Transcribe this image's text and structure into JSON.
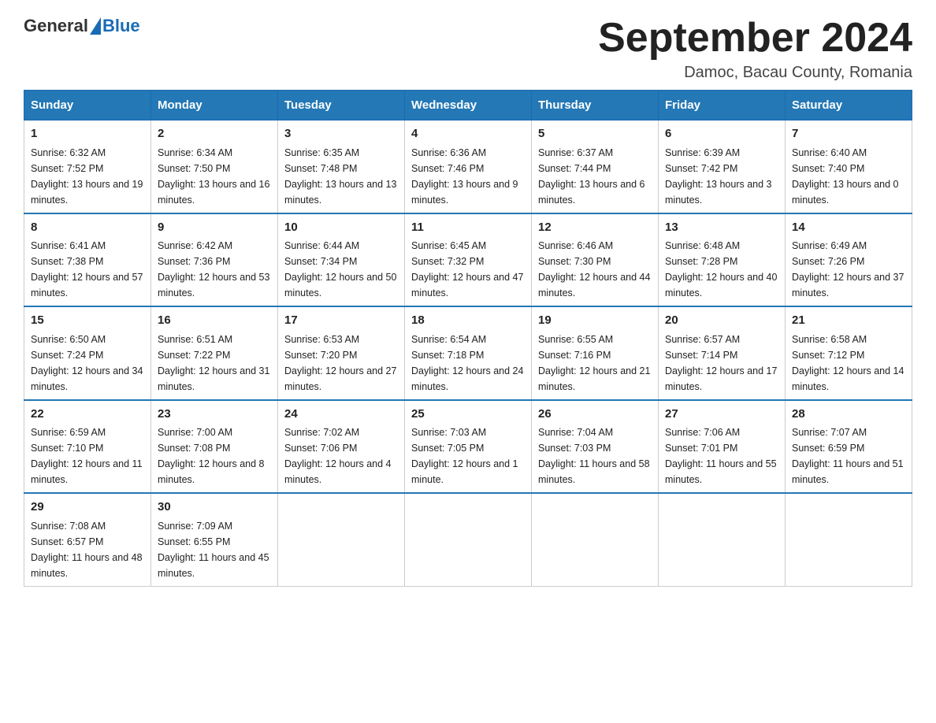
{
  "header": {
    "logo_general": "General",
    "logo_blue": "Blue",
    "month_title": "September 2024",
    "location": "Damoc, Bacau County, Romania"
  },
  "weekdays": [
    "Sunday",
    "Monday",
    "Tuesday",
    "Wednesday",
    "Thursday",
    "Friday",
    "Saturday"
  ],
  "weeks": [
    [
      {
        "day": "1",
        "sunrise": "Sunrise: 6:32 AM",
        "sunset": "Sunset: 7:52 PM",
        "daylight": "Daylight: 13 hours and 19 minutes."
      },
      {
        "day": "2",
        "sunrise": "Sunrise: 6:34 AM",
        "sunset": "Sunset: 7:50 PM",
        "daylight": "Daylight: 13 hours and 16 minutes."
      },
      {
        "day": "3",
        "sunrise": "Sunrise: 6:35 AM",
        "sunset": "Sunset: 7:48 PM",
        "daylight": "Daylight: 13 hours and 13 minutes."
      },
      {
        "day": "4",
        "sunrise": "Sunrise: 6:36 AM",
        "sunset": "Sunset: 7:46 PM",
        "daylight": "Daylight: 13 hours and 9 minutes."
      },
      {
        "day": "5",
        "sunrise": "Sunrise: 6:37 AM",
        "sunset": "Sunset: 7:44 PM",
        "daylight": "Daylight: 13 hours and 6 minutes."
      },
      {
        "day": "6",
        "sunrise": "Sunrise: 6:39 AM",
        "sunset": "Sunset: 7:42 PM",
        "daylight": "Daylight: 13 hours and 3 minutes."
      },
      {
        "day": "7",
        "sunrise": "Sunrise: 6:40 AM",
        "sunset": "Sunset: 7:40 PM",
        "daylight": "Daylight: 13 hours and 0 minutes."
      }
    ],
    [
      {
        "day": "8",
        "sunrise": "Sunrise: 6:41 AM",
        "sunset": "Sunset: 7:38 PM",
        "daylight": "Daylight: 12 hours and 57 minutes."
      },
      {
        "day": "9",
        "sunrise": "Sunrise: 6:42 AM",
        "sunset": "Sunset: 7:36 PM",
        "daylight": "Daylight: 12 hours and 53 minutes."
      },
      {
        "day": "10",
        "sunrise": "Sunrise: 6:44 AM",
        "sunset": "Sunset: 7:34 PM",
        "daylight": "Daylight: 12 hours and 50 minutes."
      },
      {
        "day": "11",
        "sunrise": "Sunrise: 6:45 AM",
        "sunset": "Sunset: 7:32 PM",
        "daylight": "Daylight: 12 hours and 47 minutes."
      },
      {
        "day": "12",
        "sunrise": "Sunrise: 6:46 AM",
        "sunset": "Sunset: 7:30 PM",
        "daylight": "Daylight: 12 hours and 44 minutes."
      },
      {
        "day": "13",
        "sunrise": "Sunrise: 6:48 AM",
        "sunset": "Sunset: 7:28 PM",
        "daylight": "Daylight: 12 hours and 40 minutes."
      },
      {
        "day": "14",
        "sunrise": "Sunrise: 6:49 AM",
        "sunset": "Sunset: 7:26 PM",
        "daylight": "Daylight: 12 hours and 37 minutes."
      }
    ],
    [
      {
        "day": "15",
        "sunrise": "Sunrise: 6:50 AM",
        "sunset": "Sunset: 7:24 PM",
        "daylight": "Daylight: 12 hours and 34 minutes."
      },
      {
        "day": "16",
        "sunrise": "Sunrise: 6:51 AM",
        "sunset": "Sunset: 7:22 PM",
        "daylight": "Daylight: 12 hours and 31 minutes."
      },
      {
        "day": "17",
        "sunrise": "Sunrise: 6:53 AM",
        "sunset": "Sunset: 7:20 PM",
        "daylight": "Daylight: 12 hours and 27 minutes."
      },
      {
        "day": "18",
        "sunrise": "Sunrise: 6:54 AM",
        "sunset": "Sunset: 7:18 PM",
        "daylight": "Daylight: 12 hours and 24 minutes."
      },
      {
        "day": "19",
        "sunrise": "Sunrise: 6:55 AM",
        "sunset": "Sunset: 7:16 PM",
        "daylight": "Daylight: 12 hours and 21 minutes."
      },
      {
        "day": "20",
        "sunrise": "Sunrise: 6:57 AM",
        "sunset": "Sunset: 7:14 PM",
        "daylight": "Daylight: 12 hours and 17 minutes."
      },
      {
        "day": "21",
        "sunrise": "Sunrise: 6:58 AM",
        "sunset": "Sunset: 7:12 PM",
        "daylight": "Daylight: 12 hours and 14 minutes."
      }
    ],
    [
      {
        "day": "22",
        "sunrise": "Sunrise: 6:59 AM",
        "sunset": "Sunset: 7:10 PM",
        "daylight": "Daylight: 12 hours and 11 minutes."
      },
      {
        "day": "23",
        "sunrise": "Sunrise: 7:00 AM",
        "sunset": "Sunset: 7:08 PM",
        "daylight": "Daylight: 12 hours and 8 minutes."
      },
      {
        "day": "24",
        "sunrise": "Sunrise: 7:02 AM",
        "sunset": "Sunset: 7:06 PM",
        "daylight": "Daylight: 12 hours and 4 minutes."
      },
      {
        "day": "25",
        "sunrise": "Sunrise: 7:03 AM",
        "sunset": "Sunset: 7:05 PM",
        "daylight": "Daylight: 12 hours and 1 minute."
      },
      {
        "day": "26",
        "sunrise": "Sunrise: 7:04 AM",
        "sunset": "Sunset: 7:03 PM",
        "daylight": "Daylight: 11 hours and 58 minutes."
      },
      {
        "day": "27",
        "sunrise": "Sunrise: 7:06 AM",
        "sunset": "Sunset: 7:01 PM",
        "daylight": "Daylight: 11 hours and 55 minutes."
      },
      {
        "day": "28",
        "sunrise": "Sunrise: 7:07 AM",
        "sunset": "Sunset: 6:59 PM",
        "daylight": "Daylight: 11 hours and 51 minutes."
      }
    ],
    [
      {
        "day": "29",
        "sunrise": "Sunrise: 7:08 AM",
        "sunset": "Sunset: 6:57 PM",
        "daylight": "Daylight: 11 hours and 48 minutes."
      },
      {
        "day": "30",
        "sunrise": "Sunrise: 7:09 AM",
        "sunset": "Sunset: 6:55 PM",
        "daylight": "Daylight: 11 hours and 45 minutes."
      },
      null,
      null,
      null,
      null,
      null
    ]
  ]
}
